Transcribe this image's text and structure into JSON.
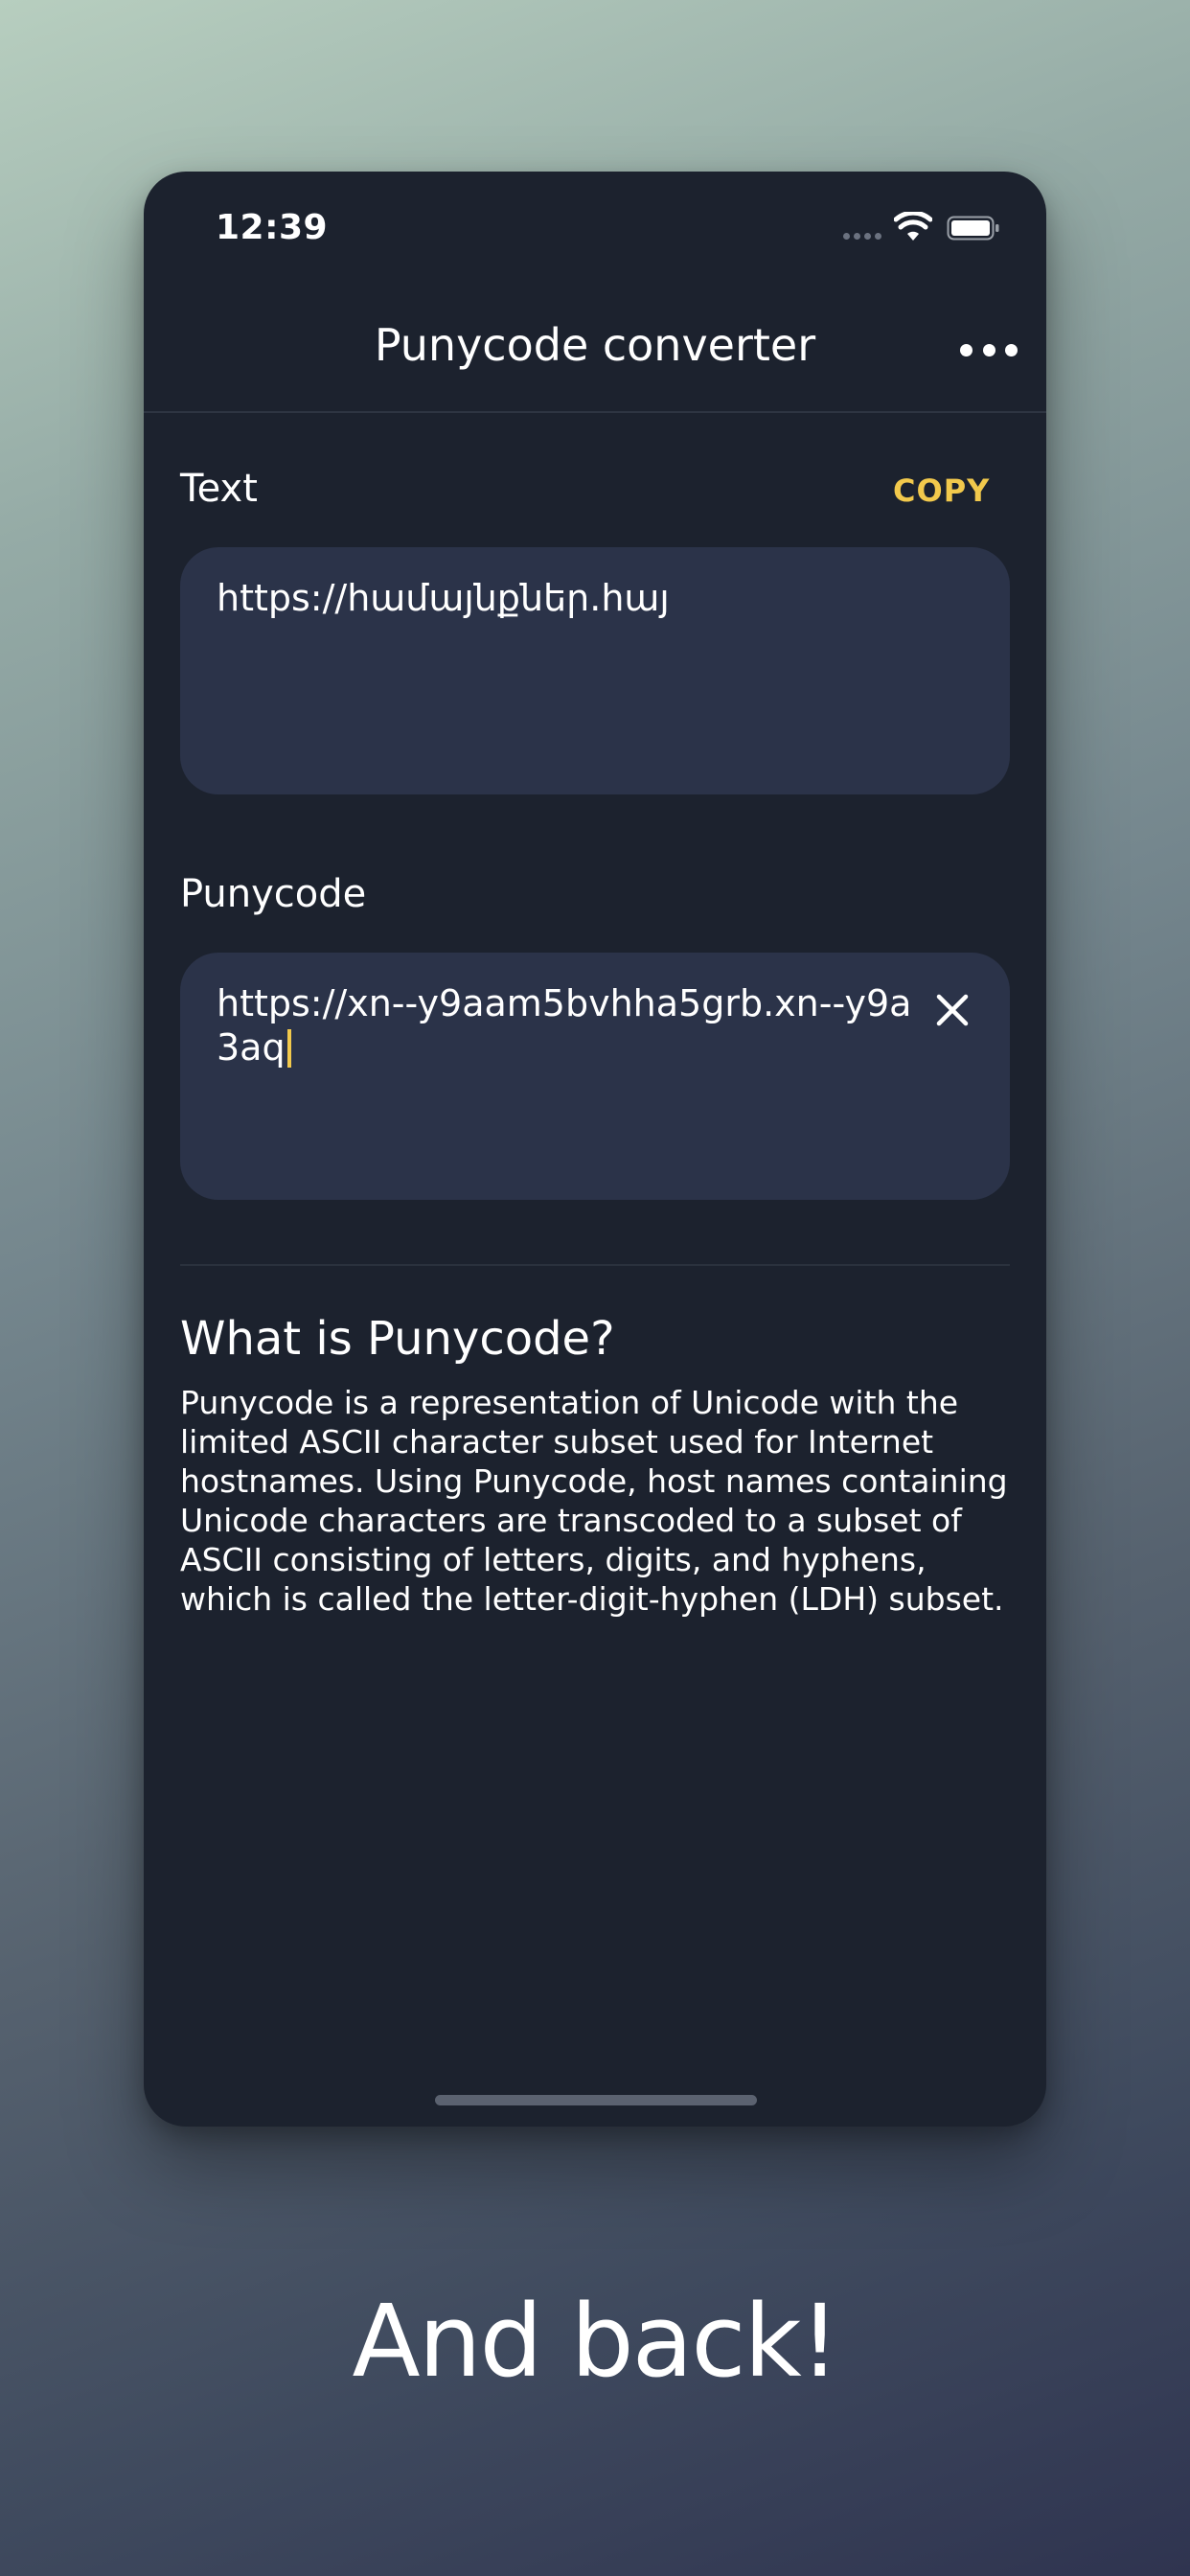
{
  "status_bar": {
    "time": "12:39",
    "icons": [
      "cellular-signal-icon",
      "wifi-icon",
      "battery-icon"
    ]
  },
  "nav": {
    "title": "Punycode converter",
    "more_icon": "more-horizontal-icon"
  },
  "text_section": {
    "label": "Text",
    "copy_label": "COPY",
    "value": "https://համայնքներ.հայ"
  },
  "punycode_section": {
    "label": "Punycode",
    "value": "https://xn--y9aam5bvhha5grb.xn--y9a3aq",
    "clear_icon": "close-icon"
  },
  "info": {
    "title": "What is Punycode?",
    "body": "Punycode is a representation of Unicode with the limited ASCII character subset used for Internet hostnames. Using Punycode, host names containing Unicode characters are transcoded to a subset of ASCII consisting of letters, digits, and hyphens, which is called the letter-digit-hyphen (LDH) subset."
  },
  "caption": "And back!",
  "colors": {
    "screen_background": "#1c222e",
    "input_background": "#2b3349",
    "accent": "#f2c94c",
    "text": "#ffffff"
  }
}
